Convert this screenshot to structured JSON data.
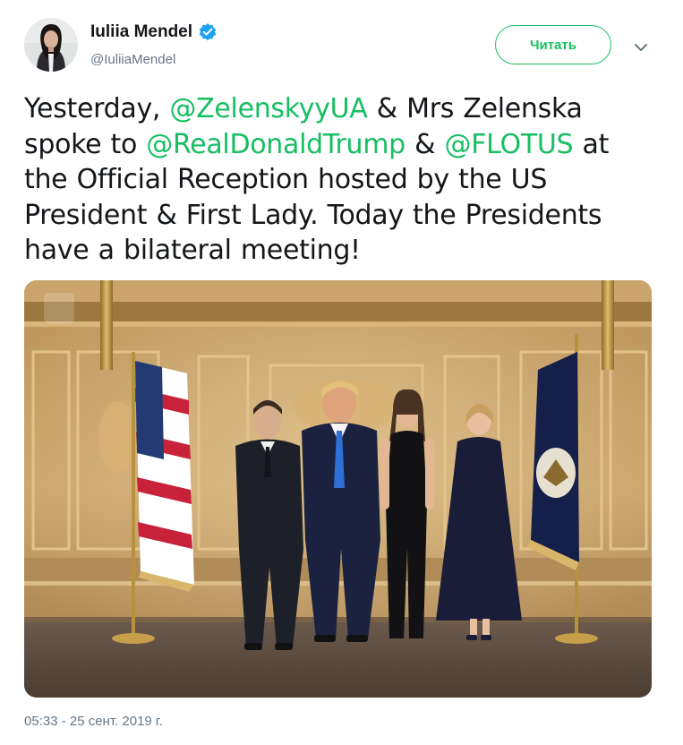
{
  "tweet": {
    "display_name": "Iuliia Mendel",
    "username": "@IuliiaMendel",
    "follow_label": "Читать",
    "text_parts": {
      "p1": "Yesterday, ",
      "m1": "@ZelenskyyUA",
      "p2": " & Mrs Zelenska spoke to ",
      "m2": "@RealDonaldTrump",
      "p3": " & ",
      "m3": "@FLOTUS",
      "p4": " at the Official Reception hosted by the US President & First Lady. Today the Presidents have  a bilateral meeting!"
    },
    "timestamp": "05:33 - 25 сент. 2019 г."
  },
  "icons": {
    "verified": "verified-badge-icon",
    "menu": "chevron-down-icon"
  },
  "colors": {
    "accent": "#17bf63",
    "verified": "#1da1f2",
    "muted": "#657786",
    "text": "#14171a"
  }
}
